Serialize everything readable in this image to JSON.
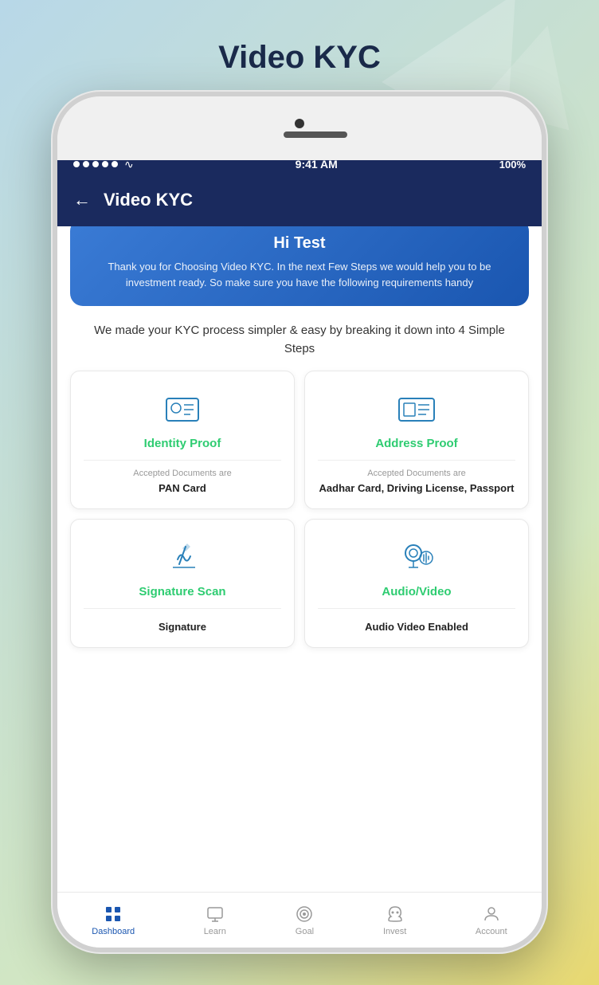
{
  "page": {
    "title": "Video KYC",
    "background_shapes": true
  },
  "status_bar": {
    "signal_dots": 5,
    "wifi": "wifi",
    "time": "9:41 AM",
    "battery": "100%"
  },
  "header": {
    "back_label": "←",
    "title": "Video KYC"
  },
  "welcome_banner": {
    "greeting": "Hi Test",
    "message": "Thank you for Choosing Video KYC. In the next Few Steps we would help you to be investment ready. So make sure you have the following requirements handy"
  },
  "description": {
    "text": "We made your KYC process simpler & easy by breaking it down into 4 Simple Steps"
  },
  "steps": [
    {
      "id": "identity-proof",
      "title": "Identity Proof",
      "accepted_label": "Accepted Documents are",
      "documents": "PAN Card",
      "icon_type": "id-card"
    },
    {
      "id": "address-proof",
      "title": "Address Proof",
      "accepted_label": "Accepted Documents are",
      "documents": "Aadhar Card, Driving License, Passport",
      "icon_type": "address-card"
    },
    {
      "id": "signature-scan",
      "title": "Signature Scan",
      "accepted_label": "",
      "documents": "Signature",
      "icon_type": "signature"
    },
    {
      "id": "audio-video",
      "title": "Audio/Video",
      "accepted_label": "",
      "documents": "Audio Video Enabled",
      "icon_type": "av"
    }
  ],
  "tab_bar": {
    "items": [
      {
        "id": "dashboard",
        "label": "Dashboard",
        "icon": "grid",
        "active": true
      },
      {
        "id": "learn",
        "label": "Learn",
        "icon": "monitor"
      },
      {
        "id": "goal",
        "label": "Goal",
        "icon": "target"
      },
      {
        "id": "invest",
        "label": "Invest",
        "icon": "piggy"
      },
      {
        "id": "account",
        "label": "Account",
        "icon": "person"
      }
    ]
  }
}
